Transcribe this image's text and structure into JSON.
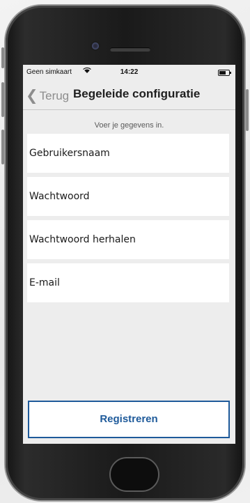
{
  "status_bar": {
    "carrier": "Geen simkaart",
    "wifi_icon": "wifi-icon",
    "time": "14:22",
    "battery_icon": "battery-icon"
  },
  "nav": {
    "back_label": "Terug",
    "back_icon": "chevron-left-icon",
    "title": "Begeleide configuratie"
  },
  "form": {
    "hint": "Voer je gegevens in.",
    "fields": {
      "username": "Gebruikersnaam",
      "password": "Wachtwoord",
      "password_repeat": "Wachtwoord herhalen",
      "email": "E-mail"
    },
    "submit_label": "Registreren"
  },
  "colors": {
    "accent": "#1e5a9a",
    "background": "#ededed",
    "field": "#ffffff"
  }
}
